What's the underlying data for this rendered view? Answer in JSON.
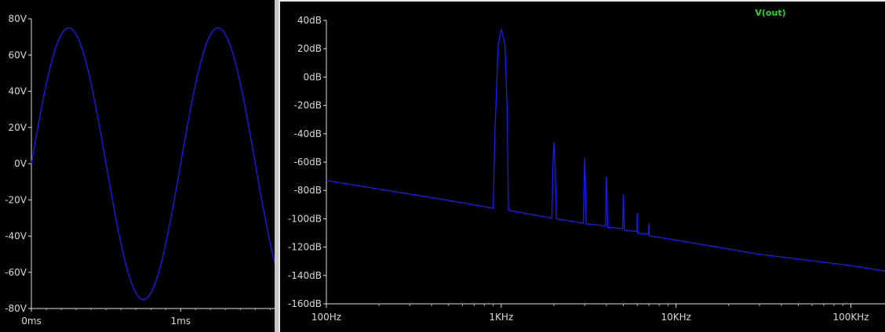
{
  "chart_data": [
    {
      "type": "line",
      "title": "",
      "xlabel": "",
      "ylabel": "",
      "x_unit": "ms",
      "xlim": [
        0,
        1.64
      ],
      "ylim": [
        -80,
        80
      ],
      "x_ticks": [
        {
          "value": 0,
          "label": "0ms"
        },
        {
          "value": 1,
          "label": "1ms"
        }
      ],
      "y_ticks": [
        {
          "value": 80,
          "label": "80V"
        },
        {
          "value": 60,
          "label": "60V"
        },
        {
          "value": 40,
          "label": "40V"
        },
        {
          "value": 20,
          "label": "20V"
        },
        {
          "value": 0,
          "label": "0V"
        },
        {
          "value": -20,
          "label": "-20V"
        },
        {
          "value": -40,
          "label": "-40V"
        },
        {
          "value": -60,
          "label": "-60V"
        },
        {
          "value": -80,
          "label": "-80V"
        }
      ],
      "series": [
        {
          "color": "#1a1aff",
          "amplitude": 75,
          "frequency_khz": 1,
          "points": [
            [
              0,
              0
            ],
            [
              0.25,
              75
            ],
            [
              0.5,
              0
            ],
            [
              0.75,
              -75
            ],
            [
              1.0,
              0
            ],
            [
              1.25,
              75
            ],
            [
              1.5,
              0
            ],
            [
              1.64,
              -58
            ]
          ]
        }
      ],
      "grid": false
    },
    {
      "type": "line",
      "title": "",
      "xlabel": "",
      "ylabel": "",
      "x_scale": "log",
      "xlim": [
        100,
        160000
      ],
      "ylim": [
        -160,
        40
      ],
      "legend": [
        {
          "name": "V(out)",
          "color": "#22dd22"
        }
      ],
      "x_ticks": [
        {
          "value": 100,
          "label": "100Hz"
        },
        {
          "value": 1000,
          "label": "1KHz"
        },
        {
          "value": 10000,
          "label": "10KHz"
        },
        {
          "value": 100000,
          "label": "100KHz"
        }
      ],
      "y_ticks": [
        {
          "value": 40,
          "label": "40dB"
        },
        {
          "value": 20,
          "label": "20dB"
        },
        {
          "value": 0,
          "label": "0dB"
        },
        {
          "value": -20,
          "label": "-20dB"
        },
        {
          "value": -40,
          "label": "-40dB"
        },
        {
          "value": -60,
          "label": "-60dB"
        },
        {
          "value": -80,
          "label": "-80dB"
        },
        {
          "value": -100,
          "label": "-100dB"
        },
        {
          "value": -120,
          "label": "-120dB"
        },
        {
          "value": -140,
          "label": "-140dB"
        },
        {
          "value": -160,
          "label": "-160dB"
        }
      ],
      "series": [
        {
          "name": "V(out)",
          "color": "#1a1aff",
          "points": [
            [
              100,
              -73
            ],
            [
              200,
              -79
            ],
            [
              500,
              -87
            ],
            [
              900,
              -92.5
            ],
            [
              920,
              -40
            ],
            [
              960,
              22
            ],
            [
              1000,
              34
            ],
            [
              1050,
              23
            ],
            [
              1080,
              -20
            ],
            [
              1100,
              -94
            ],
            [
              1950,
              -99.5
            ],
            [
              1980,
              -60
            ],
            [
              2000,
              -46
            ],
            [
              2030,
              -60
            ],
            [
              2070,
              -100
            ],
            [
              2950,
              -103
            ],
            [
              2980,
              -75
            ],
            [
              3000,
              -57
            ],
            [
              3030,
              -75
            ],
            [
              3060,
              -103.5
            ],
            [
              3950,
              -105
            ],
            [
              3970,
              -85
            ],
            [
              4000,
              -70
            ],
            [
              4030,
              -85
            ],
            [
              4060,
              -106
            ],
            [
              4950,
              -107
            ],
            [
              4970,
              -95
            ],
            [
              5000,
              -83
            ],
            [
              5030,
              -95
            ],
            [
              5060,
              -108
            ],
            [
              5970,
              -109
            ],
            [
              6000,
              -96
            ],
            [
              6030,
              -110
            ],
            [
              6970,
              -111
            ],
            [
              7000,
              -103
            ],
            [
              7030,
              -112
            ],
            [
              10000,
              -115
            ],
            [
              30000,
              -125
            ],
            [
              100000,
              -133
            ],
            [
              160000,
              -137
            ]
          ]
        }
      ],
      "grid": false
    }
  ]
}
